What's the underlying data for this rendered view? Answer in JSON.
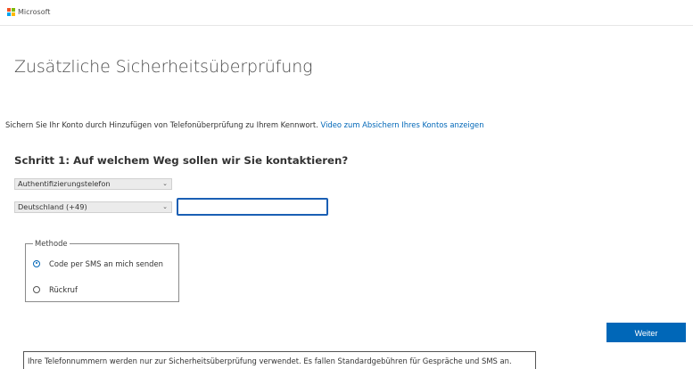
{
  "header": {
    "brand": "Microsoft",
    "logo_colors": [
      "#f25022",
      "#7fba00",
      "#00a4ef",
      "#ffb900"
    ]
  },
  "main": {
    "title": "Zusätzliche Sicherheitsüberprüfung",
    "intro_text": "Sichern Sie Ihr Konto durch Hinzufügen von Telefonüberprüfung zu Ihrem Kennwort.",
    "intro_link": "Video zum Absichern Ihres Kontos anzeigen",
    "step_heading": "Schritt 1: Auf welchem Weg sollen wir Sie kontaktieren?",
    "contact_method_select": {
      "value": "Authentifizierungstelefon",
      "icon": "chevron-down-icon"
    },
    "country_select": {
      "value": "Deutschland (+49)",
      "icon": "chevron-down-icon"
    },
    "phone_input": {
      "value": "",
      "placeholder": ""
    },
    "method_group": {
      "legend": "Methode",
      "options": [
        {
          "label": "Code per SMS an mich senden",
          "selected": true
        },
        {
          "label": "Rückruf",
          "selected": false
        }
      ]
    },
    "next_button": "Weiter",
    "notice": "Ihre Telefonnummern werden nur zur Sicherheitsüberprüfung verwendet. Es fallen Standardgebühren für Gespräche und SMS an."
  },
  "colors": {
    "accent": "#0067b8",
    "input_focus_border": "#1a5fb4"
  }
}
